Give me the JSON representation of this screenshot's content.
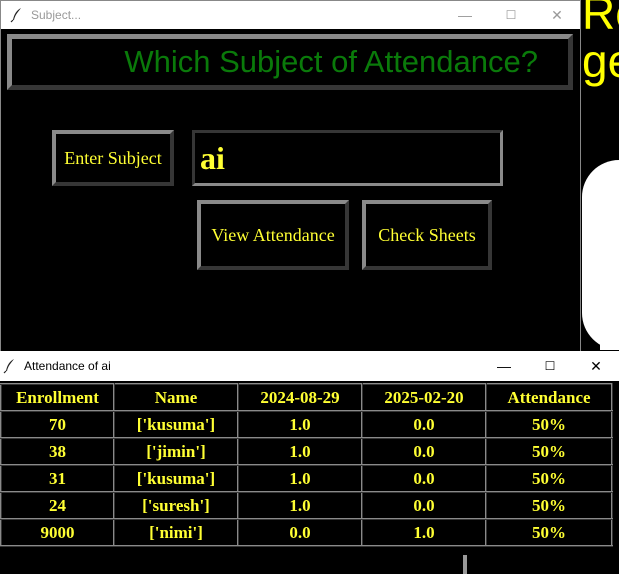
{
  "background_window": {
    "text_top": "Re",
    "text_mid": "ge"
  },
  "subject_window": {
    "title": "Subject...",
    "heading": "Which Subject of Attendance?",
    "enter_subject_label": "Enter Subject",
    "subject_value": "ai",
    "view_button_label": "View Attendance",
    "check_button_label": "Check Sheets",
    "minimize": "—",
    "maximize": "☐",
    "close": "✕"
  },
  "attendance_window": {
    "title": "Attendance of ai",
    "minimize": "—",
    "maximize": "☐",
    "close": "✕",
    "headers": [
      "Enrollment",
      "Name",
      "2024-08-29",
      "2025-02-20",
      "Attendance"
    ],
    "rows": [
      [
        "70",
        "['kusuma']",
        "1.0",
        "0.0",
        "50%"
      ],
      [
        "38",
        "['jimin']",
        "1.0",
        "0.0",
        "50%"
      ],
      [
        "31",
        "['kusuma']",
        "1.0",
        "0.0",
        "50%"
      ],
      [
        "24",
        "['suresh']",
        "1.0",
        "0.0",
        "50%"
      ],
      [
        "9000",
        "['nimi']",
        "0.0",
        "1.0",
        "50%"
      ]
    ]
  },
  "colors": {
    "text_yellow": "#ffff33",
    "heading_green": "#0a7a0a",
    "background": "#000000",
    "border_gray": "#8a8a8a"
  },
  "icons": {
    "app": "feather-icon"
  }
}
